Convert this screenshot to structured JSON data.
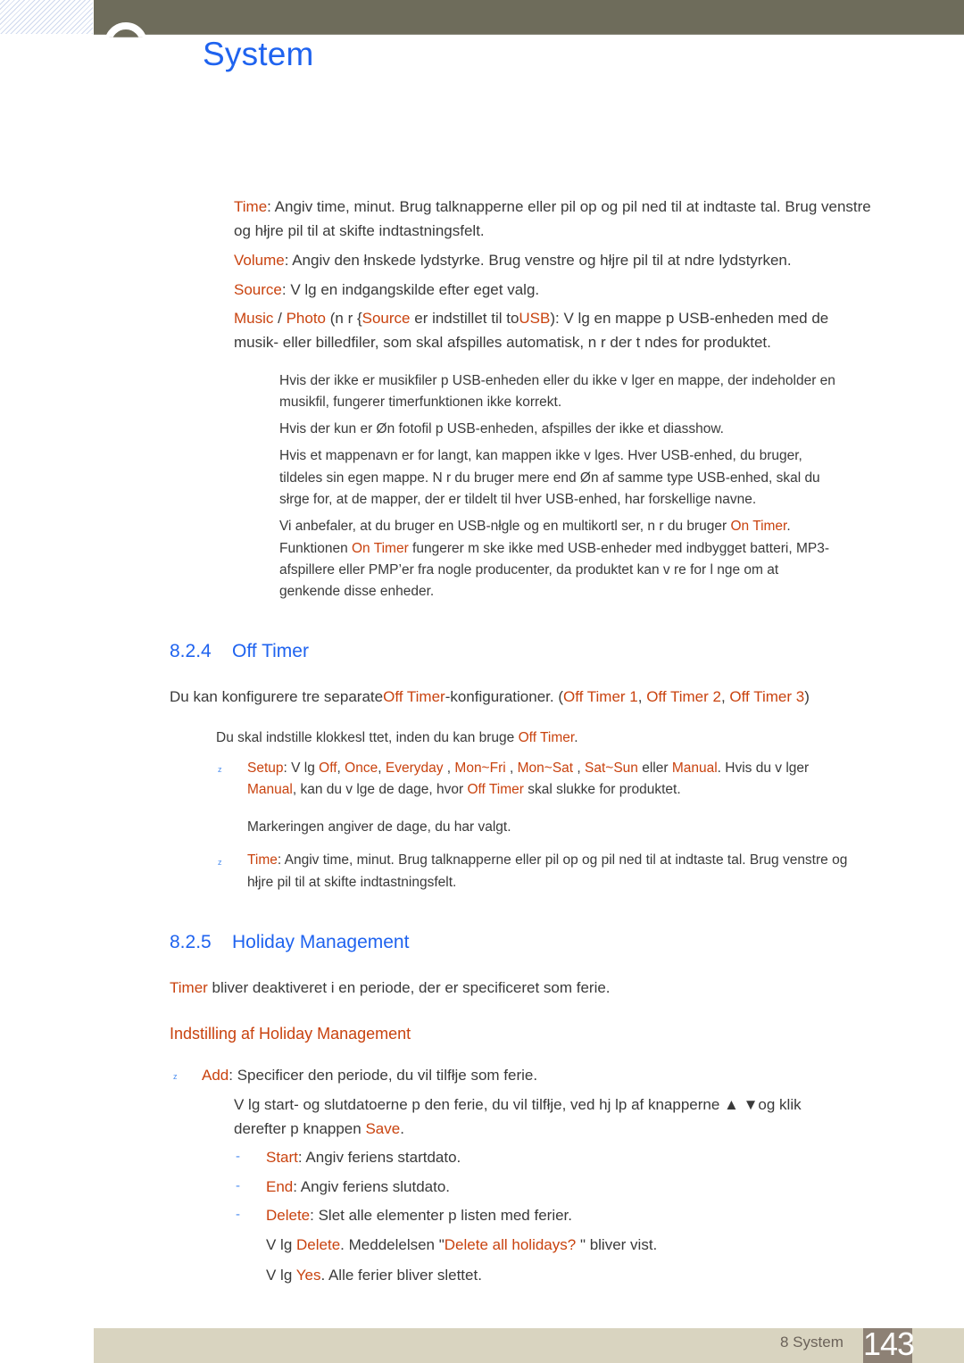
{
  "header": {
    "title": "System"
  },
  "intro_items": [
    {
      "label": "Time",
      "text": ": Angiv time, minut. Brug talknapperne eller pil op og pil ned til at indtaste tal. Brug venstre",
      "cont": "og hłjre pil til at skifte indtastningsfelt."
    },
    {
      "label": "Volume",
      "text": ": Angiv den łnskede lydstyrke. Brug venstre og hłjre pil til at  ndre lydstyrken."
    },
    {
      "label": "Source",
      "text": ": V lg en indgangskilde efter eget valg."
    },
    {
      "label_a": "Music",
      "sep": " / ",
      "label_b": "Photo",
      "mid1": " (n r {",
      "label_c": "Source",
      "mid2": " er indstillet til to",
      "label_d": "USB",
      "text": "): V lg en mappe p  USB-enheden med de",
      "cont": "musik- eller billedfiler, som skal afspilles automatisk, n r der t ndes for produktet."
    }
  ],
  "notes": [
    {
      "line1": "Hvis der ikke er musikfiler p  USB-enheden eller du ikke v lger en mappe, der indeholder en",
      "line2": "musikfil, fungerer timerfunktionen ikke korrekt."
    },
    {
      "line1": "Hvis der kun er Øn fotofil p  USB-enheden, afspilles der ikke et diasshow."
    },
    {
      "line1": "Hvis et mappenavn er for langt, kan mappen ikke v lges. Hver USB-enhed, du bruger,",
      "line2": "tildeles sin egen mappe. N r du bruger mere end Øn af samme type USB-enhed, skal du",
      "line3": "słrge for, at de mapper, der er tildelt til hver USB-enhed, har forskellige navne."
    },
    {
      "line1a": "Vi anbefaler, at du bruger en USB-nłgle og en multikortl ser, n r du bruger ",
      "line1b": "On Timer",
      "line1c": ".",
      "line2a": "Funktionen ",
      "line2b": "On Timer",
      "line2c": " fungerer m ske ikke med USB-enheder med indbygget batteri, MP3-",
      "line3": "afspillere eller PMP’er fra nogle producenter, da produktet kan v re for l nge om at",
      "line4": "genkende disse enheder."
    }
  ],
  "off_timer": {
    "number": "8.2.4",
    "title": "Off Timer",
    "intro_a": "Du kan konfigurere tre separate",
    "intro_b": "Off Timer",
    "intro_c": "-konfigurationer. (",
    "timer1": "Off Timer 1",
    "comma": ", ",
    "timer2": "Off Timer 2",
    "timer3": "Off Timer 3",
    "close": ")",
    "note_a": "Du skal indstille klokkesl ttet, inden du kan bruge ",
    "note_b": "Off Timer",
    "note_c": ".",
    "setup": {
      "label": "Setup",
      "text": ": V lg  ",
      "options": [
        "Off",
        "Once",
        "Everyday",
        "Mon~Fri",
        "Mon~Sat",
        "Sat~Sun"
      ],
      "or": " eller ",
      "manual": "Manual",
      "after": ". Hvis du v lger",
      "line2_manual": "Manual",
      "line2_a": ", kan du v lge de dage, hvor  ",
      "line2_timer": "Off Timer",
      "line2_b": " skal slukke for produktet."
    },
    "marking_note": "Markeringen angiver de dage, du har valgt.",
    "time": {
      "label": "Time",
      "text": ": Angiv time, minut. Brug talknapperne eller pil op og pil ned til at indtaste tal. Brug venstre og",
      "cont": "hłjre pil til at skifte indtastningsfelt."
    }
  },
  "holiday": {
    "number": "8.2.5",
    "title": "Holiday Management",
    "intro_a": "Timer",
    "intro_b": " bliver deaktiveret i en periode, der er specificeret som ferie.",
    "subheading": "Indstilling af Holiday Management",
    "add_label": "Add",
    "add_text": ": Specificer den periode, du vil tilfłje som ferie.",
    "add_desc1": "V lg start- og slutdatoerne p  den ferie, du vil tilfłje, ved hj lp af knapperne    ▲ ▼og klik",
    "add_desc2a": "derefter p  knappen ",
    "add_desc2b": "Save",
    "add_desc2c": ".",
    "sub_items": [
      {
        "label": "Start",
        "text": ": Angiv feriens startdato."
      },
      {
        "label": "End",
        "text": ": Angiv feriens slutdato."
      },
      {
        "label": "Delete",
        "text": ": Slet alle elementer p  listen med ferier."
      }
    ],
    "delete_step1a": "V lg  ",
    "delete_step1b": "Delete",
    "delete_step1c": ". Meddelelsen \"",
    "delete_step1d": "Delete all holidays? ",
    "delete_step1e": "\" bliver vist.",
    "delete_step2a": "V lg  ",
    "delete_step2b": "Yes",
    "delete_step2c": ". Alle ferier bliver slettet."
  },
  "bullets": {
    "z": "z",
    "dash": "-"
  },
  "footer": {
    "chapter_label": "8 System",
    "page_number": "143"
  }
}
